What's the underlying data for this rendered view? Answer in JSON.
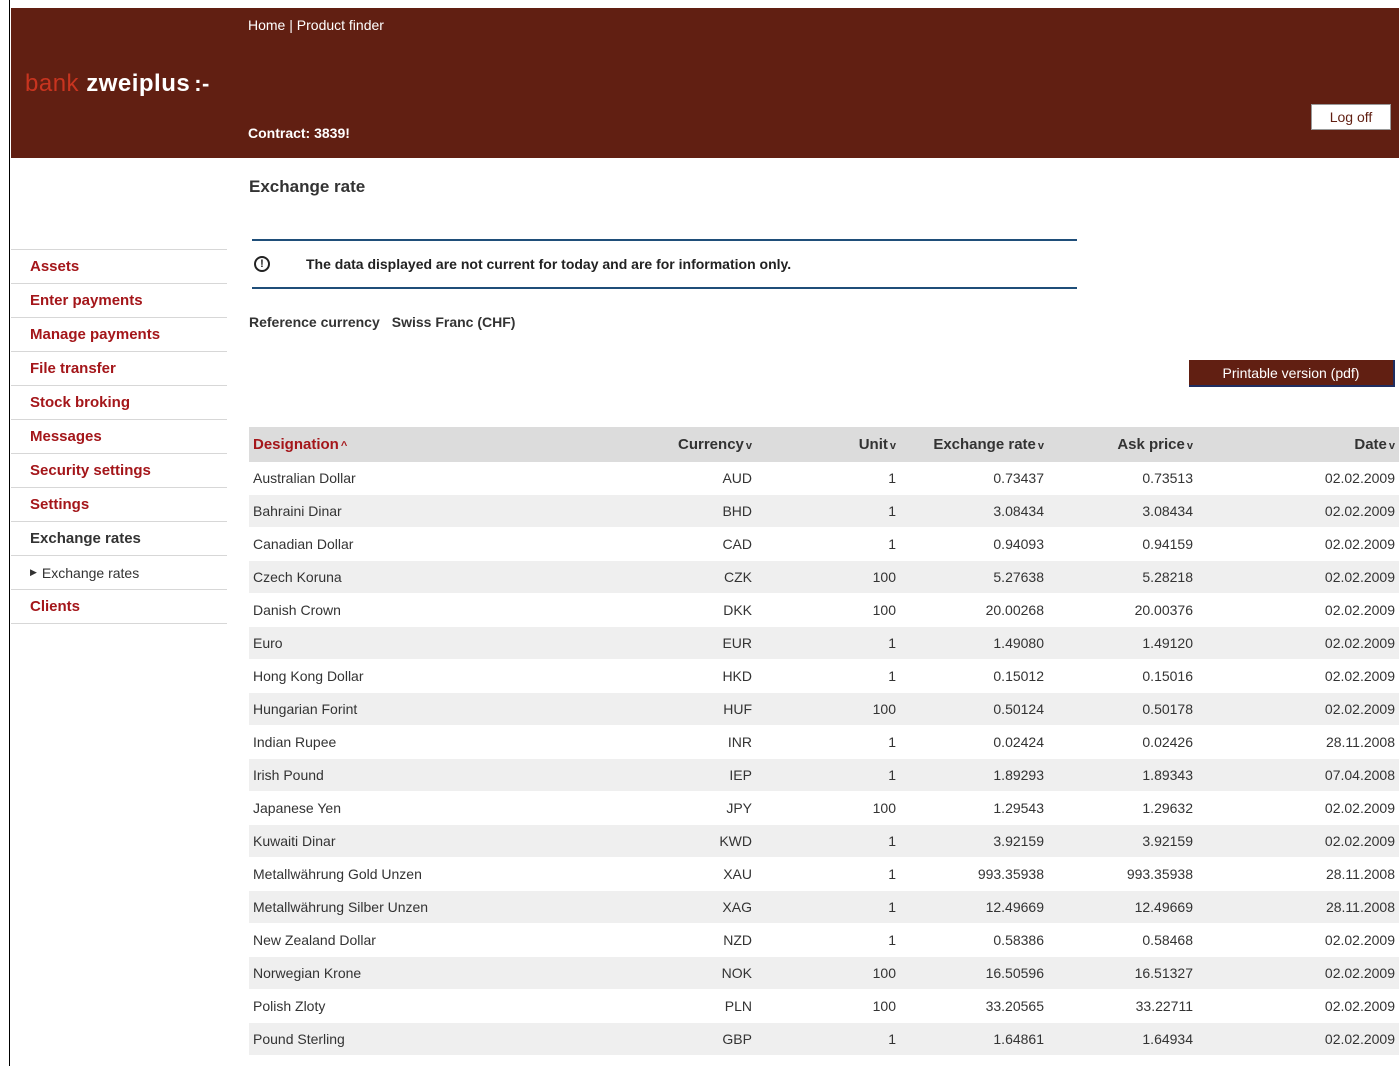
{
  "header": {
    "nav": {
      "home": "Home",
      "sep": " | ",
      "product_finder": "Product finder"
    },
    "logo": {
      "bank": "bank",
      "name": " zweiplus",
      "mark": ":-"
    },
    "contract": "Contract: 3839!",
    "logoff": "Log off"
  },
  "page_title": "Exchange rate",
  "sidebar": {
    "items": [
      {
        "label": "Assets"
      },
      {
        "label": "Enter payments"
      },
      {
        "label": "Manage payments"
      },
      {
        "label": "File transfer"
      },
      {
        "label": "Stock broking"
      },
      {
        "label": "Messages"
      },
      {
        "label": "Security settings"
      },
      {
        "label": "Settings"
      },
      {
        "label": "Exchange rates"
      },
      {
        "label": "Exchange rates"
      },
      {
        "label": "Clients"
      }
    ]
  },
  "notice": {
    "icon": "info-circle-icon",
    "text": "The data displayed are not current for today and are for information only."
  },
  "reference": {
    "label": "Reference currency",
    "value": "Swiss Franc (CHF)"
  },
  "print_button": "Printable version (pdf)",
  "table": {
    "headers": {
      "designation": "Designation",
      "currency": "Currency",
      "unit": "Unit",
      "rate": "Exchange rate",
      "ask": "Ask price",
      "date": "Date"
    },
    "sort_asc": "^",
    "sort_desc": "v",
    "rows": [
      {
        "designation": "Australian Dollar",
        "currency": "AUD",
        "unit": "1",
        "rate": "0.73437",
        "ask": "0.73513",
        "date": "02.02.2009"
      },
      {
        "designation": "Bahraini Dinar",
        "currency": "BHD",
        "unit": "1",
        "rate": "3.08434",
        "ask": "3.08434",
        "date": "02.02.2009"
      },
      {
        "designation": "Canadian Dollar",
        "currency": "CAD",
        "unit": "1",
        "rate": "0.94093",
        "ask": "0.94159",
        "date": "02.02.2009"
      },
      {
        "designation": "Czech Koruna",
        "currency": "CZK",
        "unit": "100",
        "rate": "5.27638",
        "ask": "5.28218",
        "date": "02.02.2009"
      },
      {
        "designation": "Danish Crown",
        "currency": "DKK",
        "unit": "100",
        "rate": "20.00268",
        "ask": "20.00376",
        "date": "02.02.2009"
      },
      {
        "designation": "Euro",
        "currency": "EUR",
        "unit": "1",
        "rate": "1.49080",
        "ask": "1.49120",
        "date": "02.02.2009"
      },
      {
        "designation": "Hong Kong Dollar",
        "currency": "HKD",
        "unit": "1",
        "rate": "0.15012",
        "ask": "0.15016",
        "date": "02.02.2009"
      },
      {
        "designation": "Hungarian Forint",
        "currency": "HUF",
        "unit": "100",
        "rate": "0.50124",
        "ask": "0.50178",
        "date": "02.02.2009"
      },
      {
        "designation": "Indian Rupee",
        "currency": "INR",
        "unit": "1",
        "rate": "0.02424",
        "ask": "0.02426",
        "date": "28.11.2008"
      },
      {
        "designation": "Irish Pound",
        "currency": "IEP",
        "unit": "1",
        "rate": "1.89293",
        "ask": "1.89343",
        "date": "07.04.2008"
      },
      {
        "designation": "Japanese Yen",
        "currency": "JPY",
        "unit": "100",
        "rate": "1.29543",
        "ask": "1.29632",
        "date": "02.02.2009"
      },
      {
        "designation": "Kuwaiti Dinar",
        "currency": "KWD",
        "unit": "1",
        "rate": "3.92159",
        "ask": "3.92159",
        "date": "02.02.2009"
      },
      {
        "designation": "Metallwährung Gold Unzen",
        "currency": "XAU",
        "unit": "1",
        "rate": "993.35938",
        "ask": "993.35938",
        "date": "28.11.2008"
      },
      {
        "designation": "Metallwährung Silber Unzen",
        "currency": "XAG",
        "unit": "1",
        "rate": "12.49669",
        "ask": "12.49669",
        "date": "28.11.2008"
      },
      {
        "designation": "New Zealand Dollar",
        "currency": "NZD",
        "unit": "1",
        "rate": "0.58386",
        "ask": "0.58468",
        "date": "02.02.2009"
      },
      {
        "designation": "Norwegian Krone",
        "currency": "NOK",
        "unit": "100",
        "rate": "16.50596",
        "ask": "16.51327",
        "date": "02.02.2009"
      },
      {
        "designation": "Polish Zloty",
        "currency": "PLN",
        "unit": "100",
        "rate": "33.20565",
        "ask": "33.22711",
        "date": "02.02.2009"
      },
      {
        "designation": "Pound Sterling",
        "currency": "GBP",
        "unit": "1",
        "rate": "1.64861",
        "ask": "1.64934",
        "date": "02.02.2009"
      }
    ]
  },
  "colors": {
    "header_bg": "#611f12",
    "accent_red": "#a4161a",
    "notice_border": "#1f4e79"
  }
}
